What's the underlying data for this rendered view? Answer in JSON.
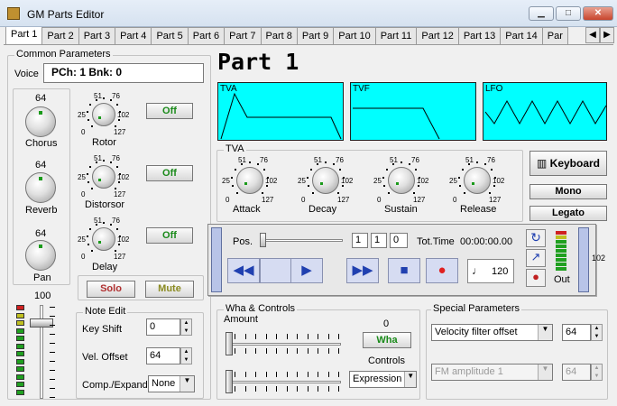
{
  "window": {
    "title": "GM Parts Editor",
    "min": "▁",
    "max": "□",
    "close": "✕"
  },
  "tabs": [
    "Part 1",
    "Part 2",
    "Part 3",
    "Part 4",
    "Part 5",
    "Part 6",
    "Part 7",
    "Part 8",
    "Part 9",
    "Part 10",
    "Part 11",
    "Part 12",
    "Part 13",
    "Part 14",
    "Par"
  ],
  "tab_nav": {
    "prev": "◀",
    "next": "▶"
  },
  "common": {
    "label": "Common Parameters",
    "voice_label": "Voice",
    "voice_value": "PCh: 1 Bnk: 0",
    "knobs": [
      {
        "name": "Chorus",
        "value": "64"
      },
      {
        "name": "Reverb",
        "value": "64"
      },
      {
        "name": "Pan",
        "value": "64"
      }
    ],
    "effects": [
      {
        "name": "Rotor",
        "toggle": "Off"
      },
      {
        "name": "Distorsor",
        "toggle": "Off"
      },
      {
        "name": "Delay",
        "toggle": "Off"
      }
    ],
    "scale": {
      "s0": "0",
      "s25": "25",
      "s51": "51",
      "s76": "76",
      "s102": "102",
      "s127": "127"
    },
    "volume": "100",
    "solo": "Solo",
    "mute": "Mute"
  },
  "part_title": "Part 1",
  "env": {
    "tva": "TVA",
    "tvf": "TVF",
    "lfo": "LFO"
  },
  "tva_panel": {
    "label": "TVA",
    "knobs": [
      "Attack",
      "Decay",
      "Sustain",
      "Release"
    ]
  },
  "right_buttons": {
    "keyboard": "Keyboard",
    "mono": "Mono",
    "legato": "Legato"
  },
  "transport": {
    "pos_label": "Pos.",
    "bar": "1",
    "beat": "1",
    "tick": "0",
    "tot_label": "Tot.Time",
    "tot_value": "00:00:00.00",
    "tempo": "120",
    "out_label": "Out",
    "side_value": "102"
  },
  "note_edit": {
    "label": "Note Edit",
    "key_shift_label": "Key Shift",
    "key_shift": "0",
    "vel_offset_label": "Vel. Offset",
    "vel_offset": "64",
    "comp_label": "Comp./Expand",
    "comp": "None"
  },
  "wha": {
    "label": "Wha & Controls",
    "amount_label": "Amount",
    "value": "0",
    "button": "Wha",
    "controls_label": "Controls",
    "controls_value": "Expression"
  },
  "special": {
    "label": "Special Parameters",
    "param1": "Velocity filter offset",
    "value1": "64",
    "param2": "FM amplitude 1",
    "value2": "64"
  },
  "colors": {
    "envelope": "#00ffff",
    "accent_green": "#1a8a1a",
    "mute_olive": "#8a8a20",
    "solo_red": "#b03030"
  }
}
